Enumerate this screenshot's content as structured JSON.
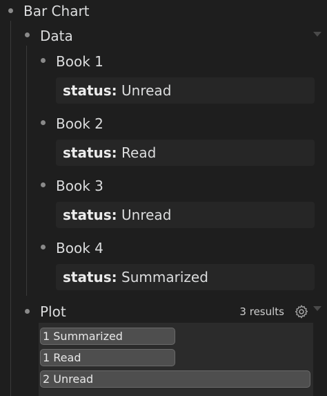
{
  "root": {
    "label": "Bar Chart"
  },
  "data_section": {
    "label": "Data",
    "books": [
      {
        "label": "Book 1",
        "key": "status:",
        "value": "Unread"
      },
      {
        "label": "Book 2",
        "key": "status:",
        "value": "Read"
      },
      {
        "label": "Book 3",
        "key": "status:",
        "value": "Unread"
      },
      {
        "label": "Book 4",
        "key": "status:",
        "value": "Summarized"
      }
    ]
  },
  "plot": {
    "label": "Plot",
    "results": "3 results",
    "bars": [
      {
        "label": "1 Summarized",
        "fraction": 0.5
      },
      {
        "label": "1 Read",
        "fraction": 0.5
      },
      {
        "label": "2 Unread",
        "fraction": 1.0
      }
    ]
  },
  "icons": {
    "settings": "gear-icon",
    "collapse": "chevron-down-icon"
  }
}
